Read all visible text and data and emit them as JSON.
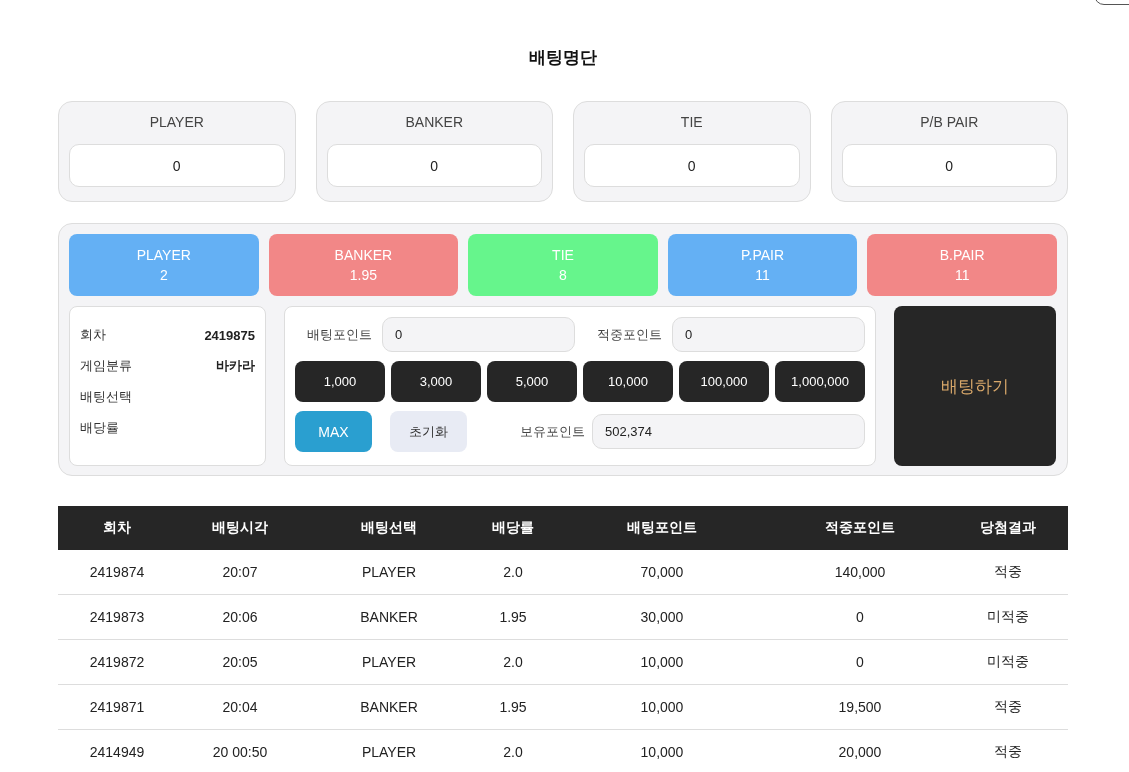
{
  "title": "배팅명단",
  "totals": [
    {
      "label": "PLAYER",
      "value": "0"
    },
    {
      "label": "BANKER",
      "value": "0"
    },
    {
      "label": "TIE",
      "value": "0"
    },
    {
      "label": "P/B PAIR",
      "value": "0"
    }
  ],
  "options": [
    {
      "label": "PLAYER",
      "odds": "2",
      "color": "#64b0f4"
    },
    {
      "label": "BANKER",
      "odds": "1.95",
      "color": "#f28787"
    },
    {
      "label": "TIE",
      "odds": "8",
      "color": "#66f58c"
    },
    {
      "label": "P.PAIR",
      "odds": "11",
      "color": "#64b0f4"
    },
    {
      "label": "B.PAIR",
      "odds": "11",
      "color": "#f28787"
    }
  ],
  "info": [
    {
      "label": "회차",
      "value": "2419875"
    },
    {
      "label": "게임분류",
      "value": "바카라"
    },
    {
      "label": "배팅선택"
    },
    {
      "label": "배당률"
    }
  ],
  "bet_point": {
    "label": "배팅포인트",
    "value": "0"
  },
  "win_point": {
    "label": "적중포인트",
    "value": "0"
  },
  "chips": [
    "1,000",
    "3,000",
    "5,000",
    "10,000",
    "100,000",
    "1,000,000"
  ],
  "max_button": "MAX",
  "reset_button": "초기화",
  "held_point": {
    "label": "보유포인트",
    "value": "502,374"
  },
  "bet_button": "배팅하기",
  "table": {
    "columns": [
      "회차",
      "배팅시각",
      "배팅선택",
      "배당률",
      "배팅포인트",
      "적중포인트",
      "당첨결과"
    ],
    "rows": [
      [
        "2419874",
        "20:07",
        "PLAYER",
        "2.0",
        "70,000",
        "140,000",
        "적중"
      ],
      [
        "2419873",
        "20:06",
        "BANKER",
        "1.95",
        "30,000",
        "0",
        "미적중"
      ],
      [
        "2419872",
        "20:05",
        "PLAYER",
        "2.0",
        "10,000",
        "0",
        "미적중"
      ],
      [
        "2419871",
        "20:04",
        "BANKER",
        "1.95",
        "10,000",
        "19,500",
        "적중"
      ],
      [
        "2414949",
        "20 00:50",
        "PLAYER",
        "2.0",
        "10,000",
        "20,000",
        "적중"
      ]
    ]
  }
}
